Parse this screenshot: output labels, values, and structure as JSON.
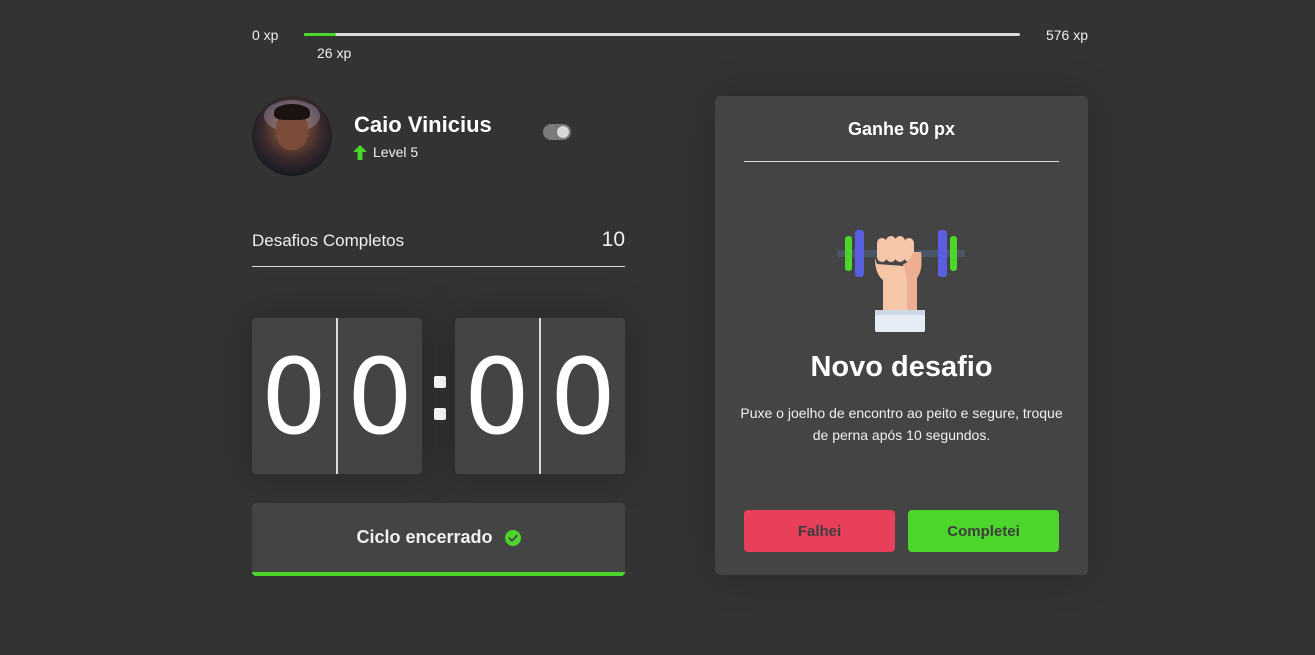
{
  "xp": {
    "min_label": "0 xp",
    "max_label": "576 xp",
    "current_label": "26 xp",
    "current": 26,
    "max": 576
  },
  "profile": {
    "name": "Caio Vinicius",
    "level_label": "Level 5"
  },
  "challenges": {
    "label": "Desafios Completos",
    "count": "10"
  },
  "countdown": {
    "minute_left": "0",
    "minute_right": "0",
    "second_left": "0",
    "second_right": "0"
  },
  "cycle": {
    "label": "Ciclo encerrado"
  },
  "challenge_card": {
    "header": "Ganhe 50 px",
    "title": "Novo desafio",
    "description": "Puxe o joelho de encontro ao peito e segure, troque de perna após 10 segundos.",
    "fail_label": "Falhei",
    "complete_label": "Completei"
  },
  "colors": {
    "background": "#333333",
    "panel": "#444444",
    "accent_green": "#4cd62b",
    "accent_red": "#e83f5b"
  },
  "icons": {
    "level": "arrow-up-icon",
    "cycle": "check-circle-icon",
    "challenge": "dumbbell-icon"
  }
}
